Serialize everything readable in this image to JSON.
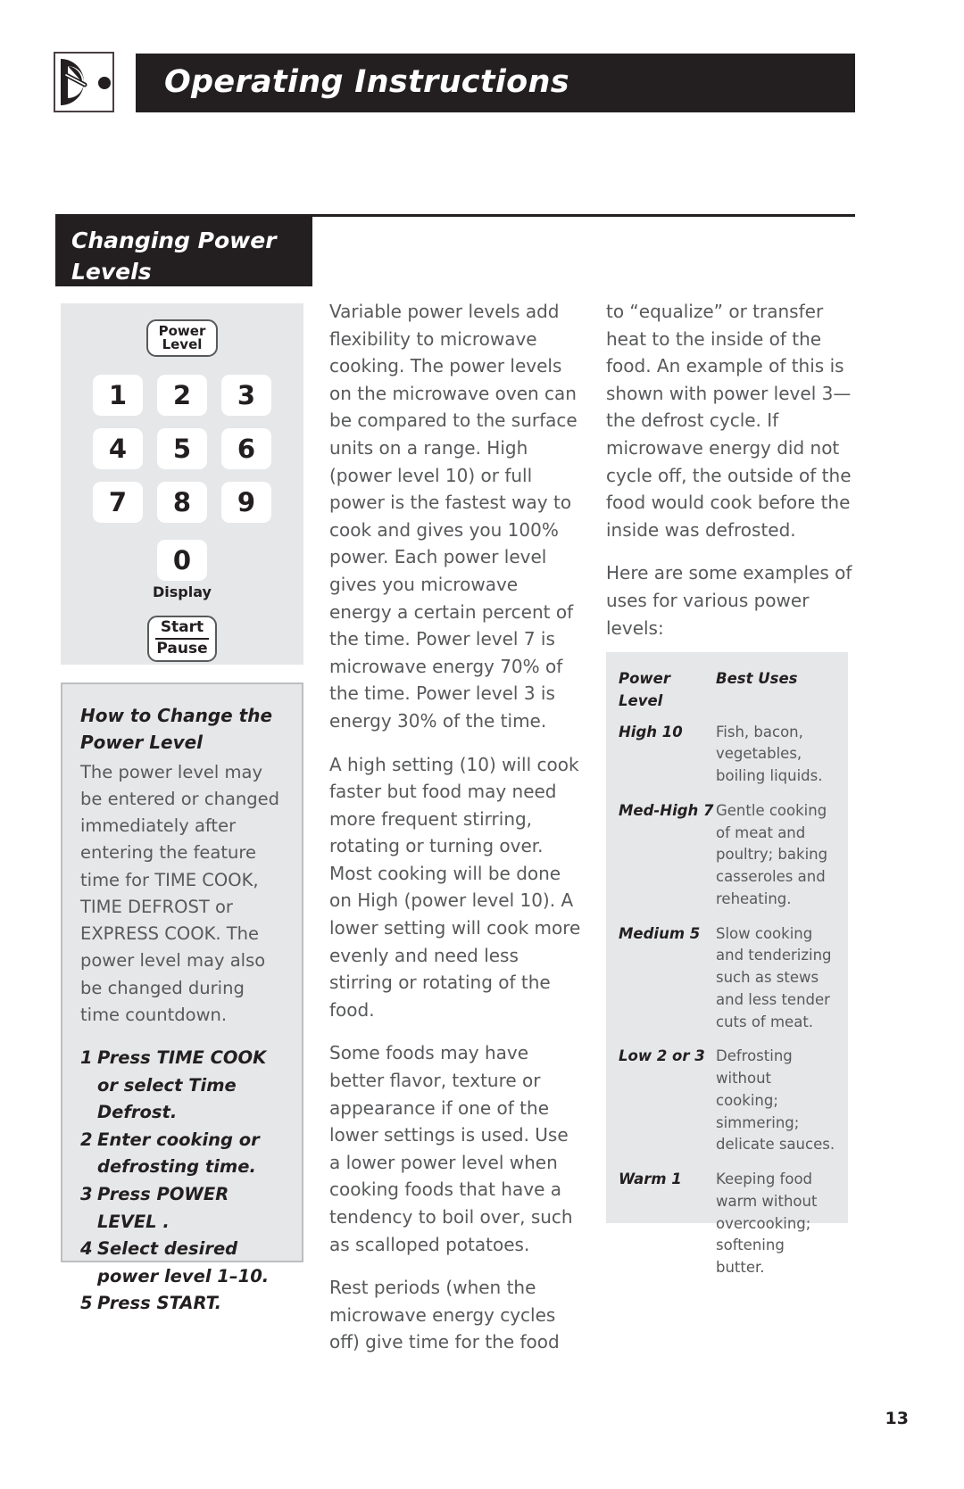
{
  "header": {
    "title": "Operating Instructions",
    "icon": "knob-dial-icon"
  },
  "section": {
    "title_line1": "Changing Power",
    "title_line2": "Levels"
  },
  "keypad": {
    "power_level_line1": "Power",
    "power_level_line2": "Level",
    "keys": [
      "1",
      "2",
      "3",
      "4",
      "5",
      "6",
      "7",
      "8",
      "9"
    ],
    "zero_key": "0",
    "display_label": "Display",
    "start_label": "Start",
    "pause_label": "Pause"
  },
  "howto": {
    "heading": "How to Change the Power Level",
    "body": "The power level may be entered or changed immediately after entering the feature time for TIME COOK, TIME DEFROST or EXPRESS COOK. The power level may also be changed during time countdown.",
    "steps": [
      {
        "num": "1",
        "text": "Press TIME COOK or select Time Defrost."
      },
      {
        "num": "2",
        "text": "Enter cooking or defrosting time."
      },
      {
        "num": "3",
        "text": "Press POWER LEVEL ."
      },
      {
        "num": "4",
        "text": "Select desired power level 1–10."
      },
      {
        "num": "5",
        "text": "Press START."
      }
    ]
  },
  "middle_column": {
    "paragraphs": [
      "Variable power levels add flexibility to microwave cooking. The power levels on the microwave oven can be compared to the surface units on a range. High (power level 10) or full power is the fastest way to cook and gives you 100% power. Each power level gives you microwave energy a certain percent of the time. Power level 7 is microwave energy 70% of the time. Power level 3 is energy 30% of the time.",
      "A high setting (10) will cook faster but food may need more frequent stirring, rotating or turning over. Most cooking will be done on High (power level 10). A lower setting will cook more evenly and need less stirring or rotating of the food.",
      "Some foods may have better flavor, texture or appearance if one of the lower settings is used. Use a lower power level when cooking foods that have a tendency to boil over, such as scalloped potatoes.",
      "Rest periods (when the microwave energy cycles off) give time for the food"
    ]
  },
  "right_column": {
    "paragraphs": [
      "to “equalize” or transfer heat to the inside of the food. An example of this is shown with power level 3—the defrost cycle. If microwave energy did not cycle off, the outside of the food would cook before the inside was defrosted.",
      "Here are some examples of uses for various power levels:"
    ]
  },
  "uses_table": {
    "header": {
      "level": "Power Level",
      "desc": "Best Uses"
    },
    "rows": [
      {
        "level": "High 10",
        "desc": "Fish, bacon, vegetables, boiling liquids."
      },
      {
        "level": "Med-High 7",
        "desc": "Gentle cooking of meat and poultry; baking casseroles and reheating."
      },
      {
        "level": "Medium 5",
        "desc": "Slow cooking and tenderizing such as stews and less tender cuts of meat."
      },
      {
        "level": "Low 2 or 3",
        "desc": "Defrosting without cooking; simmering; delicate sauces."
      },
      {
        "level": "Warm 1",
        "desc": "Keeping food warm without overcooking; softening butter."
      }
    ]
  },
  "page": {
    "number": "13"
  }
}
